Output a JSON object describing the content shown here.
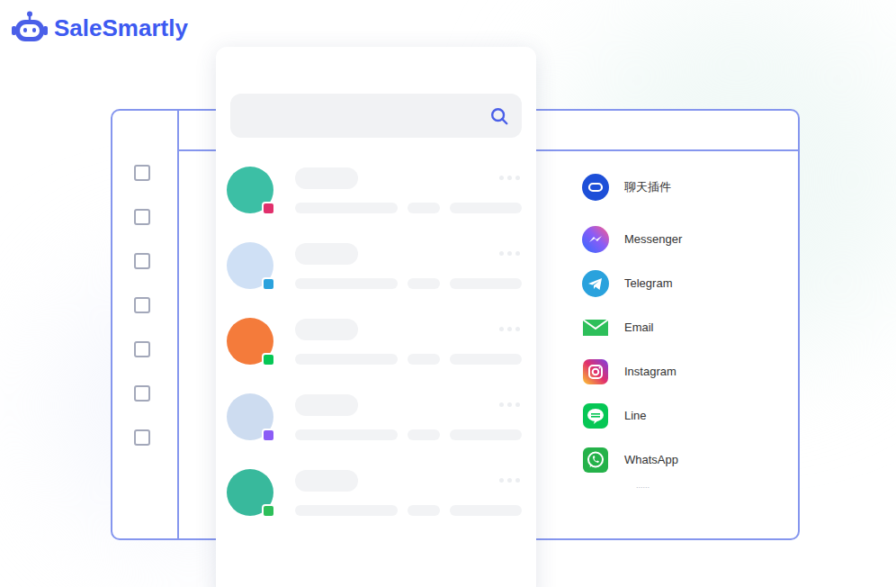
{
  "logo": {
    "text": "SaleSmartly"
  },
  "sidebar": {
    "checkboxes": [
      {
        "checked": false
      },
      {
        "checked": false
      },
      {
        "checked": false
      },
      {
        "checked": false
      },
      {
        "checked": false
      },
      {
        "checked": false
      },
      {
        "checked": false
      }
    ]
  },
  "contacts": [
    {
      "color": "#3cbfa5",
      "kind": "instagram"
    },
    {
      "color": "#cfe0f5",
      "kind": "telegram"
    },
    {
      "color": "#f47b3b",
      "kind": "line"
    },
    {
      "color": "#cddcf0",
      "kind": "messenger"
    },
    {
      "color": "#38b99c",
      "kind": "email"
    }
  ],
  "channels": [
    {
      "name": "聊天插件",
      "kind": "chat-plugin",
      "color": "#1d4fd8"
    },
    {
      "name": "Messenger",
      "kind": "messenger",
      "color": "#8b5cf6"
    },
    {
      "name": "Telegram",
      "kind": "telegram",
      "color": "#2aa2dd"
    },
    {
      "name": "Email",
      "kind": "email",
      "color": "#2dbf5a"
    },
    {
      "name": "Instagram",
      "kind": "instagram",
      "color": "#e1306c"
    },
    {
      "name": "Line",
      "kind": "line",
      "color": "#06c755"
    },
    {
      "name": "WhatsApp",
      "kind": "whatsapp",
      "color": "#25b24a"
    }
  ],
  "more": "......"
}
